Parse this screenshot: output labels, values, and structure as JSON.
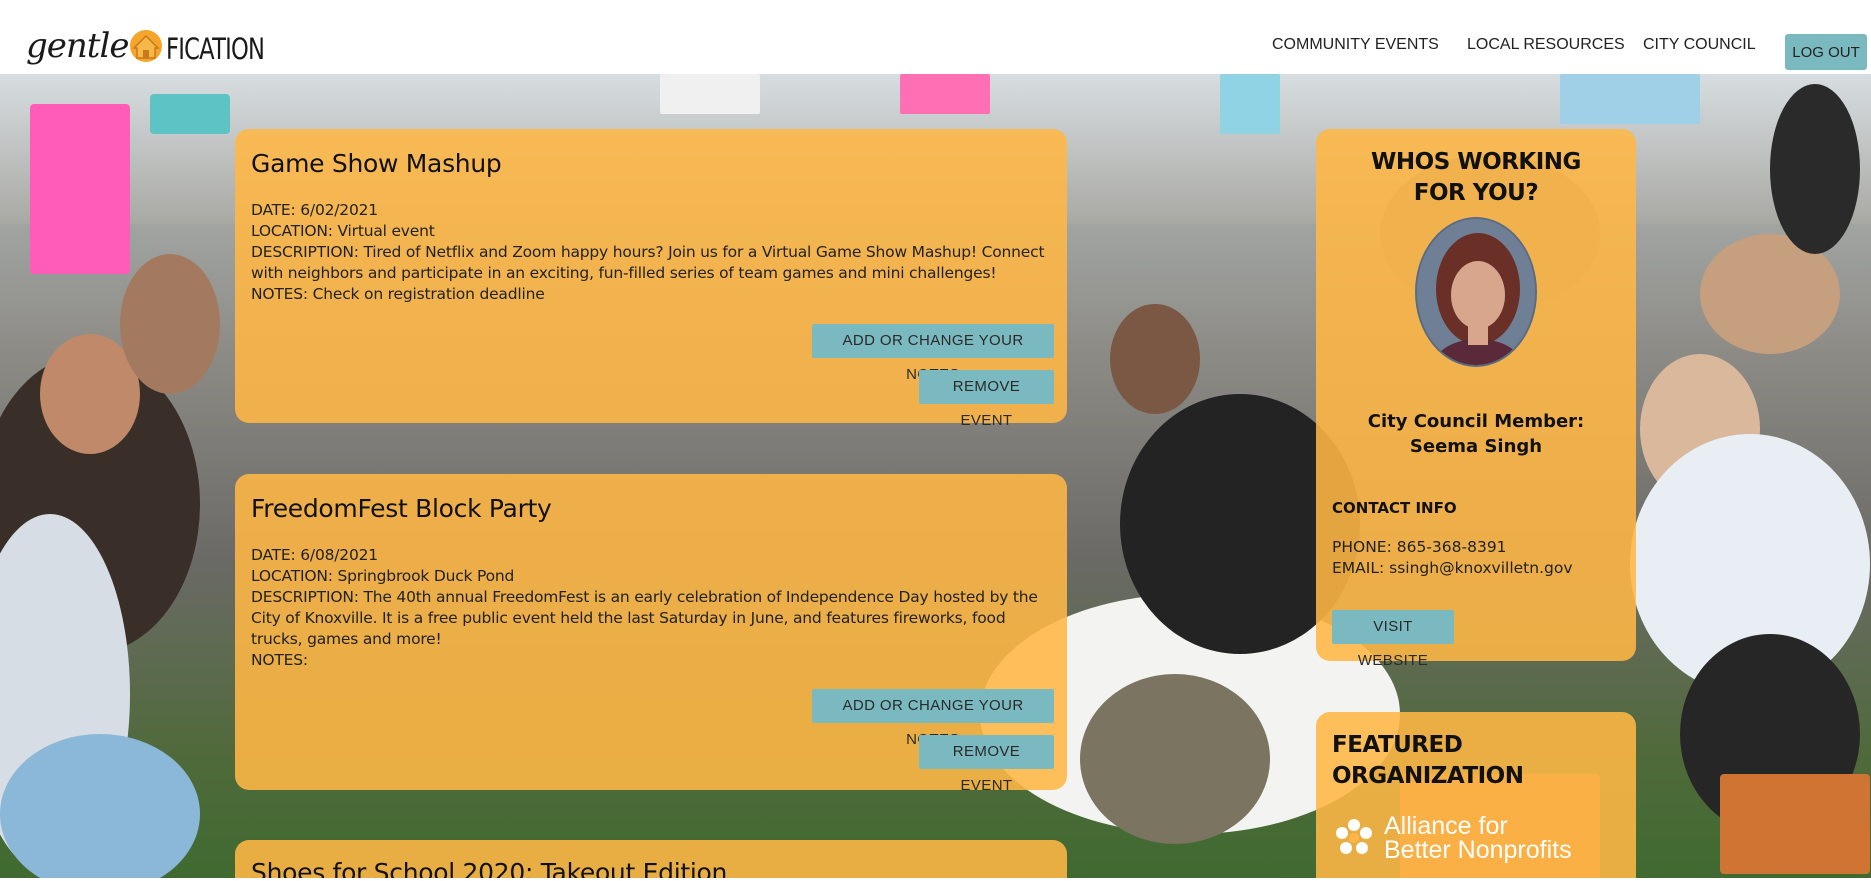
{
  "brand": {
    "script_part": "gentle",
    "caps_part": "FICATION"
  },
  "nav": {
    "items": [
      {
        "label": "COMMUNITY EVENTS"
      },
      {
        "label": "LOCAL RESOURCES"
      },
      {
        "label": "CITY COUNCIL"
      }
    ],
    "logout_label": "LOG OUT"
  },
  "events": [
    {
      "title": "Game Show Mashup",
      "date": "DATE: 6/02/2021",
      "location": "LOCATION: Virtual event",
      "description": "DESCRIPTION: Tired of Netflix and Zoom happy hours? Join us for a Virtual Game Show Mashup! Connect with neighbors and participate in an exciting, fun-filled series of team games and mini challenges!",
      "notes": "NOTES: Check on registration deadline",
      "notes_button": "ADD OR CHANGE YOUR NOTES",
      "remove_button": "REMOVE EVENT"
    },
    {
      "title": "FreedomFest Block Party",
      "date": "DATE: 6/08/2021",
      "location": "LOCATION: Springbrook Duck Pond",
      "description": "DESCRIPTION: The 40th annual FreedomFest is an early celebration of Independence Day hosted by the City of Knoxville. It is a free public event held the last Saturday in June, and features fireworks, food trucks, games and more!",
      "notes": "NOTES:",
      "notes_button": "ADD OR CHANGE YOUR NOTES",
      "remove_button": "REMOVE EVENT"
    },
    {
      "title": "Shoes for School 2020: Takeout Edition"
    }
  ],
  "council": {
    "heading": "WHOS WORKING FOR YOU?",
    "member_label": "City Council Member:",
    "member_name": "Seema Singh",
    "contact_heading": "CONTACT INFO",
    "phone": "PHONE: 865-368-8391",
    "email": "EMAIL: ssingh@knoxvilletn.gov",
    "website_button": "VISIT WEBSITE"
  },
  "featured": {
    "heading": "FEATURED ORGANIZATION",
    "org_line1": "Alliance for",
    "org_line2": "Better Nonprofits"
  },
  "colors": {
    "card": "#ffb746",
    "button": "#7ab9bf",
    "logo_accent": "#f4a52a"
  }
}
